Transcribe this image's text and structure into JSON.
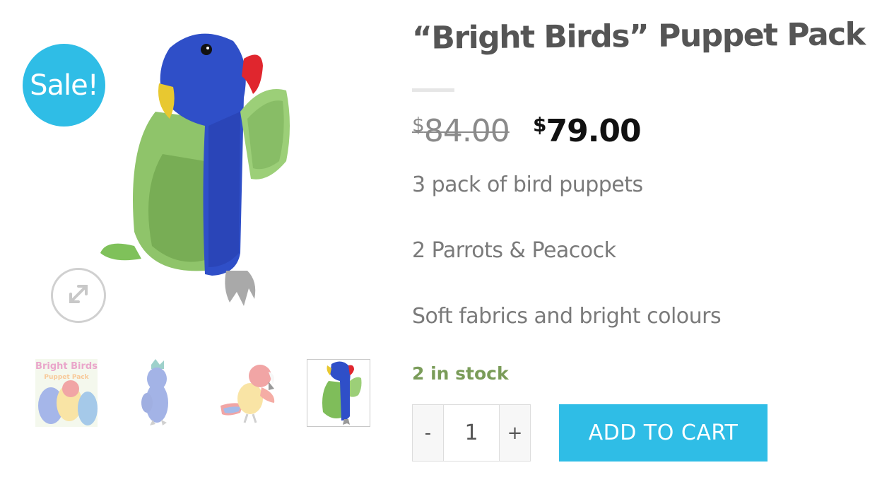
{
  "gallery": {
    "sale_badge": "Sale!",
    "zoom_icon": "expand-icon",
    "thumbnails": [
      {
        "label_line1": "Bright Birds",
        "label_line2": "Puppet Pack"
      },
      {},
      {},
      {}
    ]
  },
  "product": {
    "title": "“Bright Birds” Puppet Pack",
    "currency": "$",
    "old_price": "84.00",
    "new_price": "79.00",
    "description": [
      "3 pack of bird puppets",
      "2 Parrots & Peacock",
      "Soft fabrics and bright colours"
    ],
    "stock": "2 in stock",
    "quantity": "1",
    "minus_label": "-",
    "plus_label": "+",
    "add_to_cart_label": "ADD TO CART"
  },
  "colors": {
    "accent": "#2fbde6",
    "stock": "#7a9c59",
    "title": "#555555"
  }
}
